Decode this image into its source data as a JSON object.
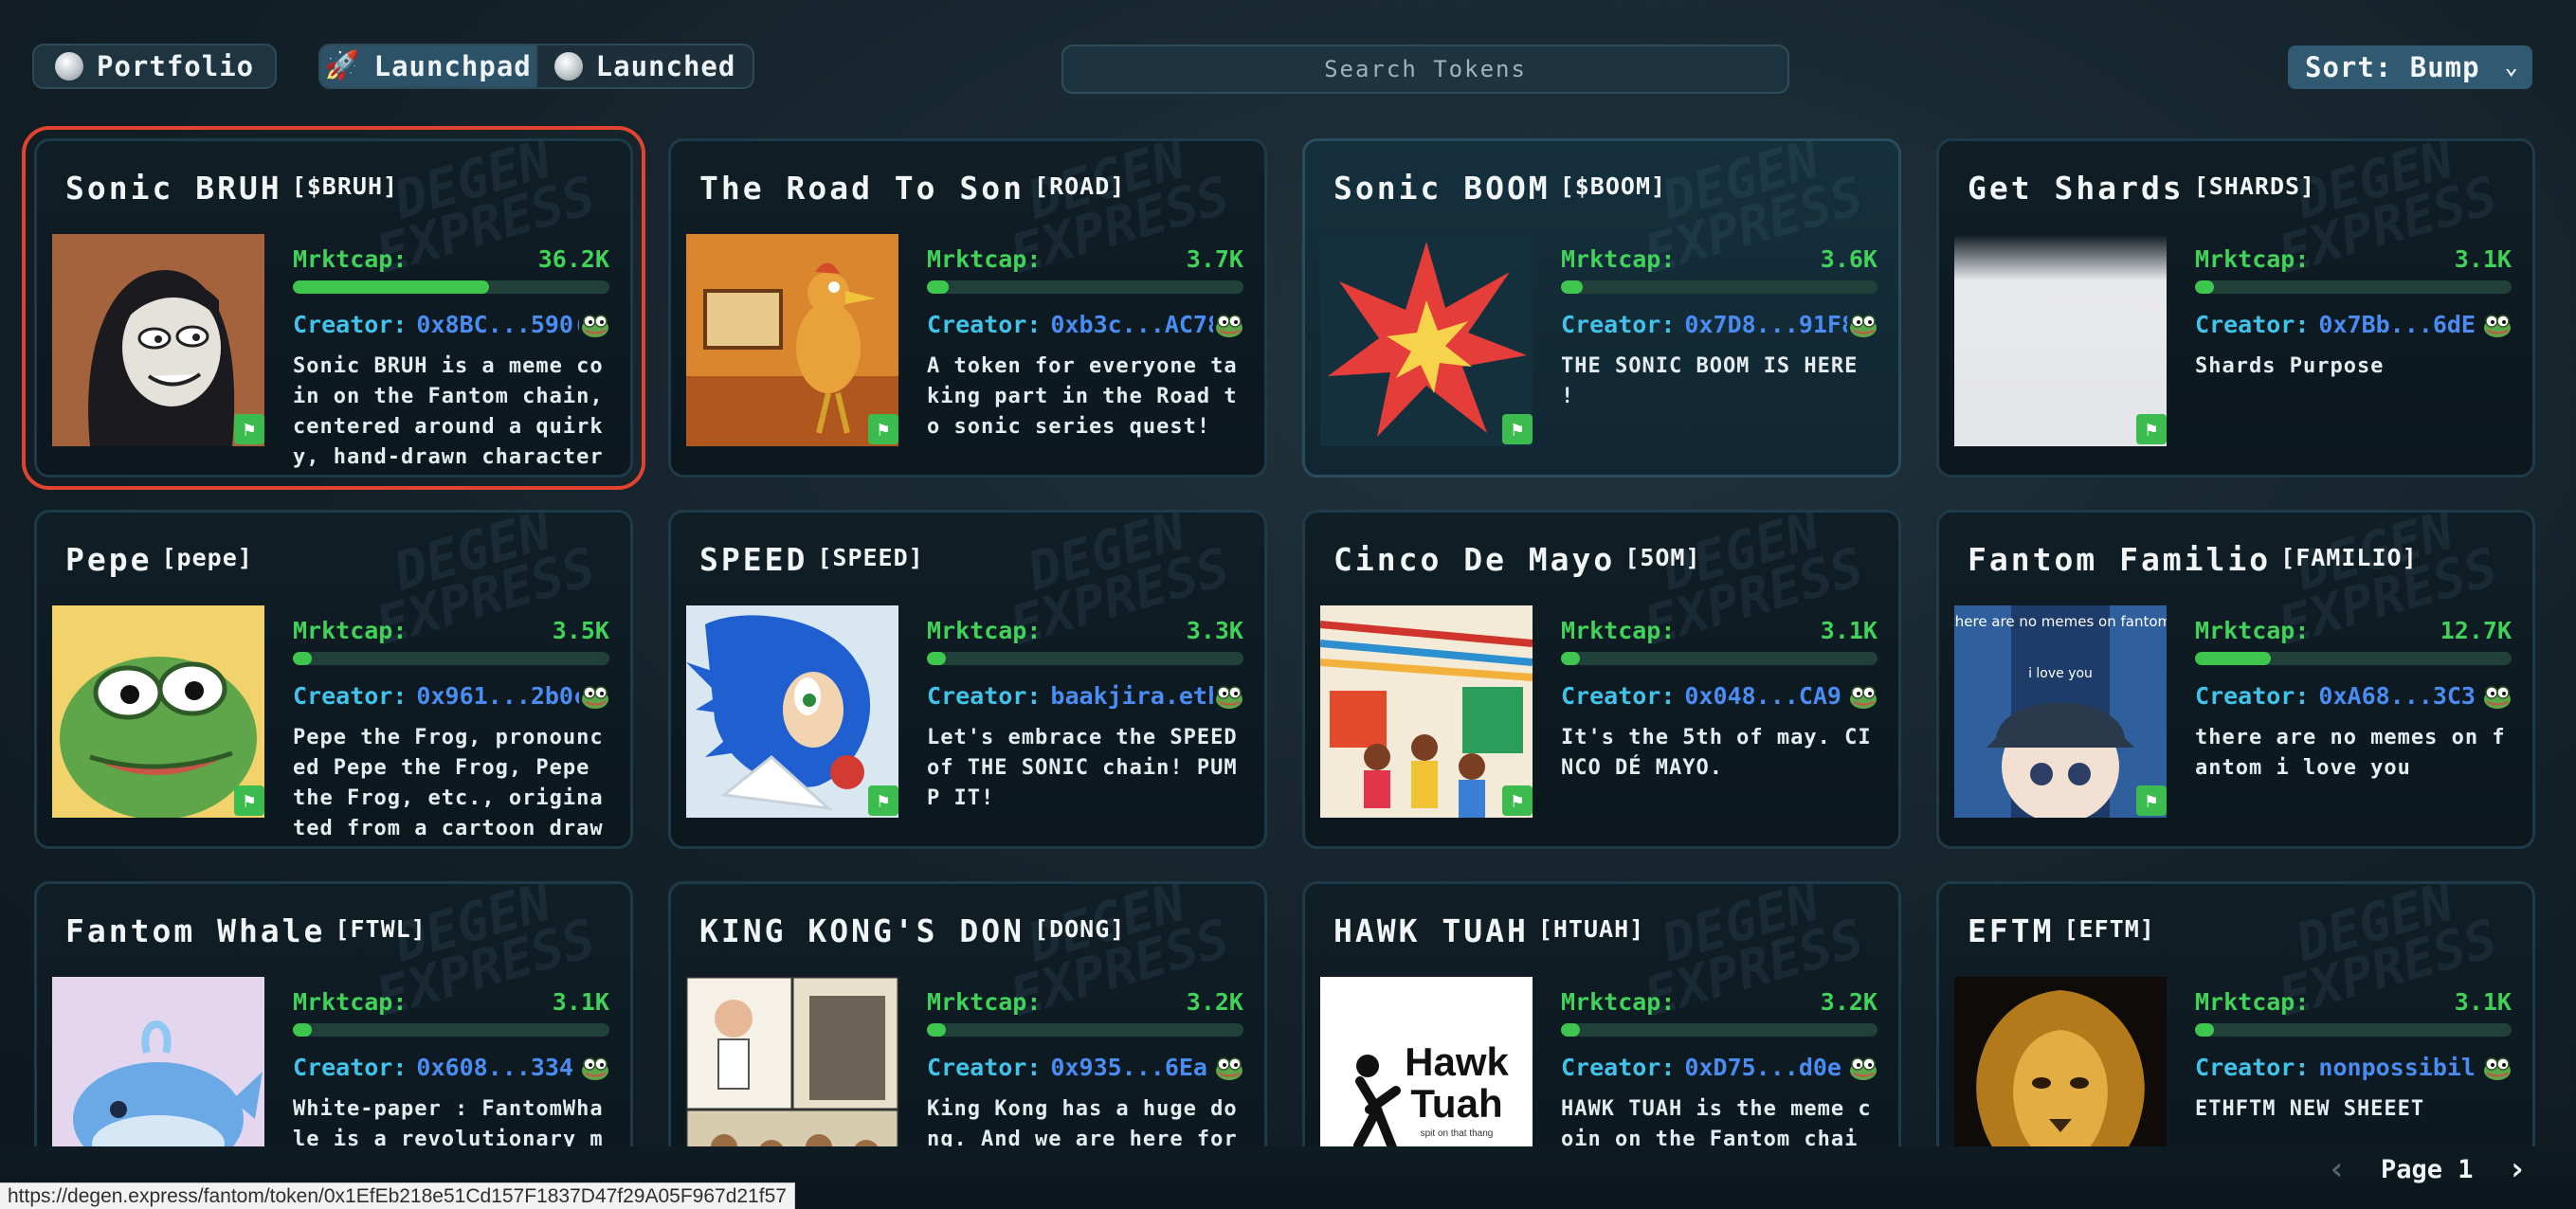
{
  "nav": {
    "portfolio_label": "Portfolio",
    "launchpad_label": "Launchpad",
    "launched_label": "Launched",
    "search_placeholder": "Search Tokens",
    "sort_label": "Sort: Bump"
  },
  "watermark_text": "DEGEN EXPRESS",
  "cards": [
    {
      "name": "Sonic BRUH",
      "ticker": "[$BRUH]",
      "mcap_label": "Mrktcap:",
      "mcap": "36.2K",
      "progress": 0.62,
      "creator_label": "Creator:",
      "creator": "0x8BC...590(",
      "desc": "Sonic BRUH is a meme coin on the Fantom chain, centered around a quirky, hand-drawn character",
      "image": "hooded-figure"
    },
    {
      "name": "The Road To Son",
      "ticker": "[ROAD]",
      "mcap_label": "Mrktcap:",
      "mcap": "3.7K",
      "progress": 0.07,
      "creator_label": "Creator:",
      "creator": "0xb3c...AC78",
      "desc": "A token for everyone taking part in the Road to sonic series quest!",
      "image": "cartoon-bird"
    },
    {
      "name": "Sonic BOOM",
      "ticker": "[$BOOM]",
      "mcap_label": "Mrktcap:",
      "mcap": "3.6K",
      "progress": 0.07,
      "creator_label": "Creator:",
      "creator": "0x7D8...91F8",
      "desc": "THE SONIC BOOM IS HERE !",
      "image": "explosion-star"
    },
    {
      "name": "Get Shards",
      "ticker": "[SHARDS]",
      "mcap_label": "Mrktcap:",
      "mcap": "3.1K",
      "progress": 0.06,
      "creator_label": "Creator:",
      "creator": "0x7Bb...6dE",
      "desc": "Shards Purpose",
      "image": "blank-white"
    },
    {
      "name": "Pepe",
      "ticker": "[pepe]",
      "mcap_label": "Mrktcap:",
      "mcap": "3.5K",
      "progress": 0.06,
      "creator_label": "Creator:",
      "creator": "0x961...2b0c",
      "desc": "Pepe the Frog, pronounced Pepe the Frog, Pepe the Frog, etc., originated from a cartoon drawn",
      "image": "pepe-frog"
    },
    {
      "name": "SPEED",
      "ticker": "[SPEED]",
      "mcap_label": "Mrktcap:",
      "mcap": "3.3K",
      "progress": 0.06,
      "creator_label": "Creator:",
      "creator": "baakjira.eth",
      "desc": "Let's embrace the SPEED of THE SONIC chain! PUMP IT!",
      "image": "sonic-hedgehog"
    },
    {
      "name": "Cinco De Mayo",
      "ticker": "[5OM]",
      "mcap_label": "Mrktcap:",
      "mcap": "3.1K",
      "progress": 0.06,
      "creator_label": "Creator:",
      "creator": "0x048...CA9",
      "desc": "It's the 5th of may. CINCO DÉ MAYO.",
      "image": "fiesta-crowd"
    },
    {
      "name": "Fantom Familio",
      "ticker": "[FAMILIO]",
      "mcap_label": "Mrktcap:",
      "mcap": "12.7K",
      "progress": 0.24,
      "creator_label": "Creator:",
      "creator": "0xA68...3C3",
      "desc": "there are no memes on fantom i love you",
      "image": "anime-cap",
      "image_text_1": "there are no memes on fantom",
      "image_text_2": "i love you"
    },
    {
      "name": "Fantom Whale",
      "ticker": "[FTWL]",
      "mcap_label": "Mrktcap:",
      "mcap": "3.1K",
      "progress": 0.06,
      "creator_label": "Creator:",
      "creator": "0x608...334",
      "desc": "White-paper : FantomWhale is a revolutionary me",
      "image": "whale"
    },
    {
      "name": "KING KONG'S DON",
      "ticker": "[DONG]",
      "mcap_label": "Mrktcap:",
      "mcap": "3.2K",
      "progress": 0.06,
      "creator_label": "Creator:",
      "creator": "0x935...6Ea",
      "desc": "King Kong has a huge dong. And we are here for",
      "image": "comic-panel"
    },
    {
      "name": "HAWK TUAH",
      "ticker": "[HTUAH]",
      "mcap_label": "Mrktcap:",
      "mcap": "3.2K",
      "progress": 0.06,
      "creator_label": "Creator:",
      "creator": "0xD75...d0e",
      "desc": "HAWK TUAH is the meme coin on the Fantom chai",
      "image": "hawk-tuah-logo",
      "image_text_1": "Hawk",
      "image_text_2": "Tuah",
      "image_text_3": "spit on that thang"
    },
    {
      "name": "EFTM",
      "ticker": "[EFTM]",
      "mcap_label": "Mrktcap:",
      "mcap": "3.1K",
      "progress": 0.06,
      "creator_label": "Creator:",
      "creator": "nonpossibil",
      "desc": "ETHFTM NEW SHEEET",
      "image": "golden-lion"
    }
  ],
  "pager": {
    "label": "Page 1"
  },
  "status_url": "https://degen.express/fantom/token/0x1EfEb218e51Cd157F1837D47f29A05F967d21f57",
  "colors": {
    "accent_green": "#42d159",
    "creator_cyan": "#42c2e8",
    "address_blue": "#4a8cf2",
    "selected_outline": "#e2432f"
  }
}
